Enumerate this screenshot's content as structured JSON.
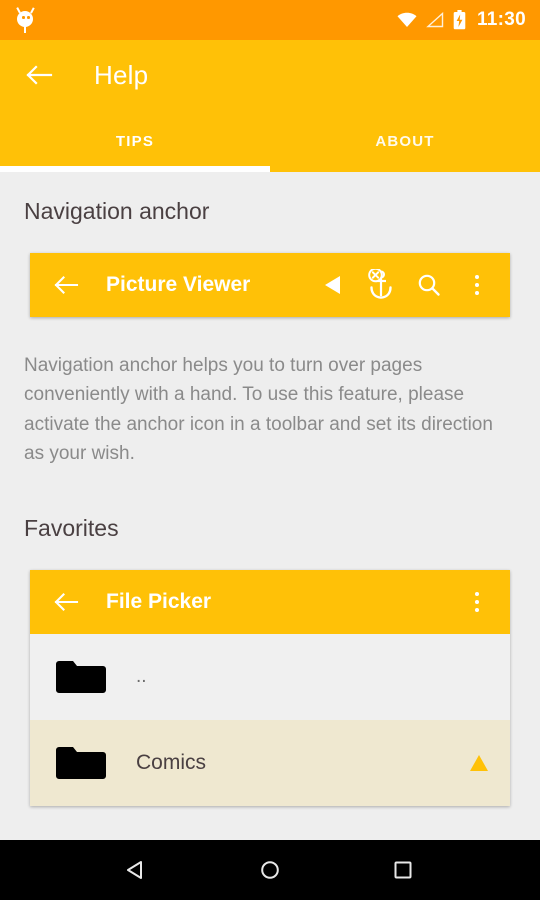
{
  "status_bar": {
    "icons": [
      "android-bug-icon",
      "wifi-icon",
      "signal-icon",
      "battery-charging-icon"
    ],
    "time": "11:30",
    "background_color": "#FF9800"
  },
  "app_bar": {
    "back_icon": "arrow-back-icon",
    "title": "Help",
    "background_color": "#FFC107"
  },
  "tabs": {
    "items": [
      {
        "label": "TIPS",
        "active": true
      },
      {
        "label": "ABOUT",
        "active": false
      }
    ],
    "indicator_color": "#FFFFFF"
  },
  "sections": [
    {
      "heading": "Navigation anchor",
      "demo": {
        "back_icon": "arrow-back-icon",
        "title": "Picture Viewer",
        "actions": [
          {
            "icon": "play-left-triangle-icon",
            "name": "direction-left-button"
          },
          {
            "icon": "anchor-disabled-icon",
            "name": "navigation-anchor-button"
          },
          {
            "icon": "search-icon",
            "name": "search-button"
          },
          {
            "icon": "more-vert-icon",
            "name": "overflow-menu-button"
          }
        ]
      },
      "body": "Navigation anchor helps you to turn over pages conveniently with a hand. To use this feature, please activate the anchor icon in a toolbar and set its direction as your wish."
    },
    {
      "heading": "Favorites",
      "demo": {
        "back_icon": "arrow-back-icon",
        "title": "File Picker",
        "actions": [
          {
            "icon": "more-vert-icon",
            "name": "overflow-menu-button"
          }
        ]
      },
      "file_list": [
        {
          "icon": "folder-icon",
          "name": "..",
          "highlight": false,
          "marker": false
        },
        {
          "icon": "folder-icon",
          "name": "Comics",
          "highlight": true,
          "marker": true
        }
      ]
    }
  ],
  "nav_bar": {
    "buttons": [
      {
        "icon": "nav-back-triangle-icon",
        "name": "system-back-button"
      },
      {
        "icon": "nav-home-circle-icon",
        "name": "system-home-button"
      },
      {
        "icon": "nav-recents-square-icon",
        "name": "system-recents-button"
      }
    ],
    "background_color": "#000000"
  },
  "colors": {
    "accent": "#FFC107",
    "status": "#FF9800",
    "page_background": "#EEEEEE",
    "highlight_row": "#EFE8D0"
  }
}
